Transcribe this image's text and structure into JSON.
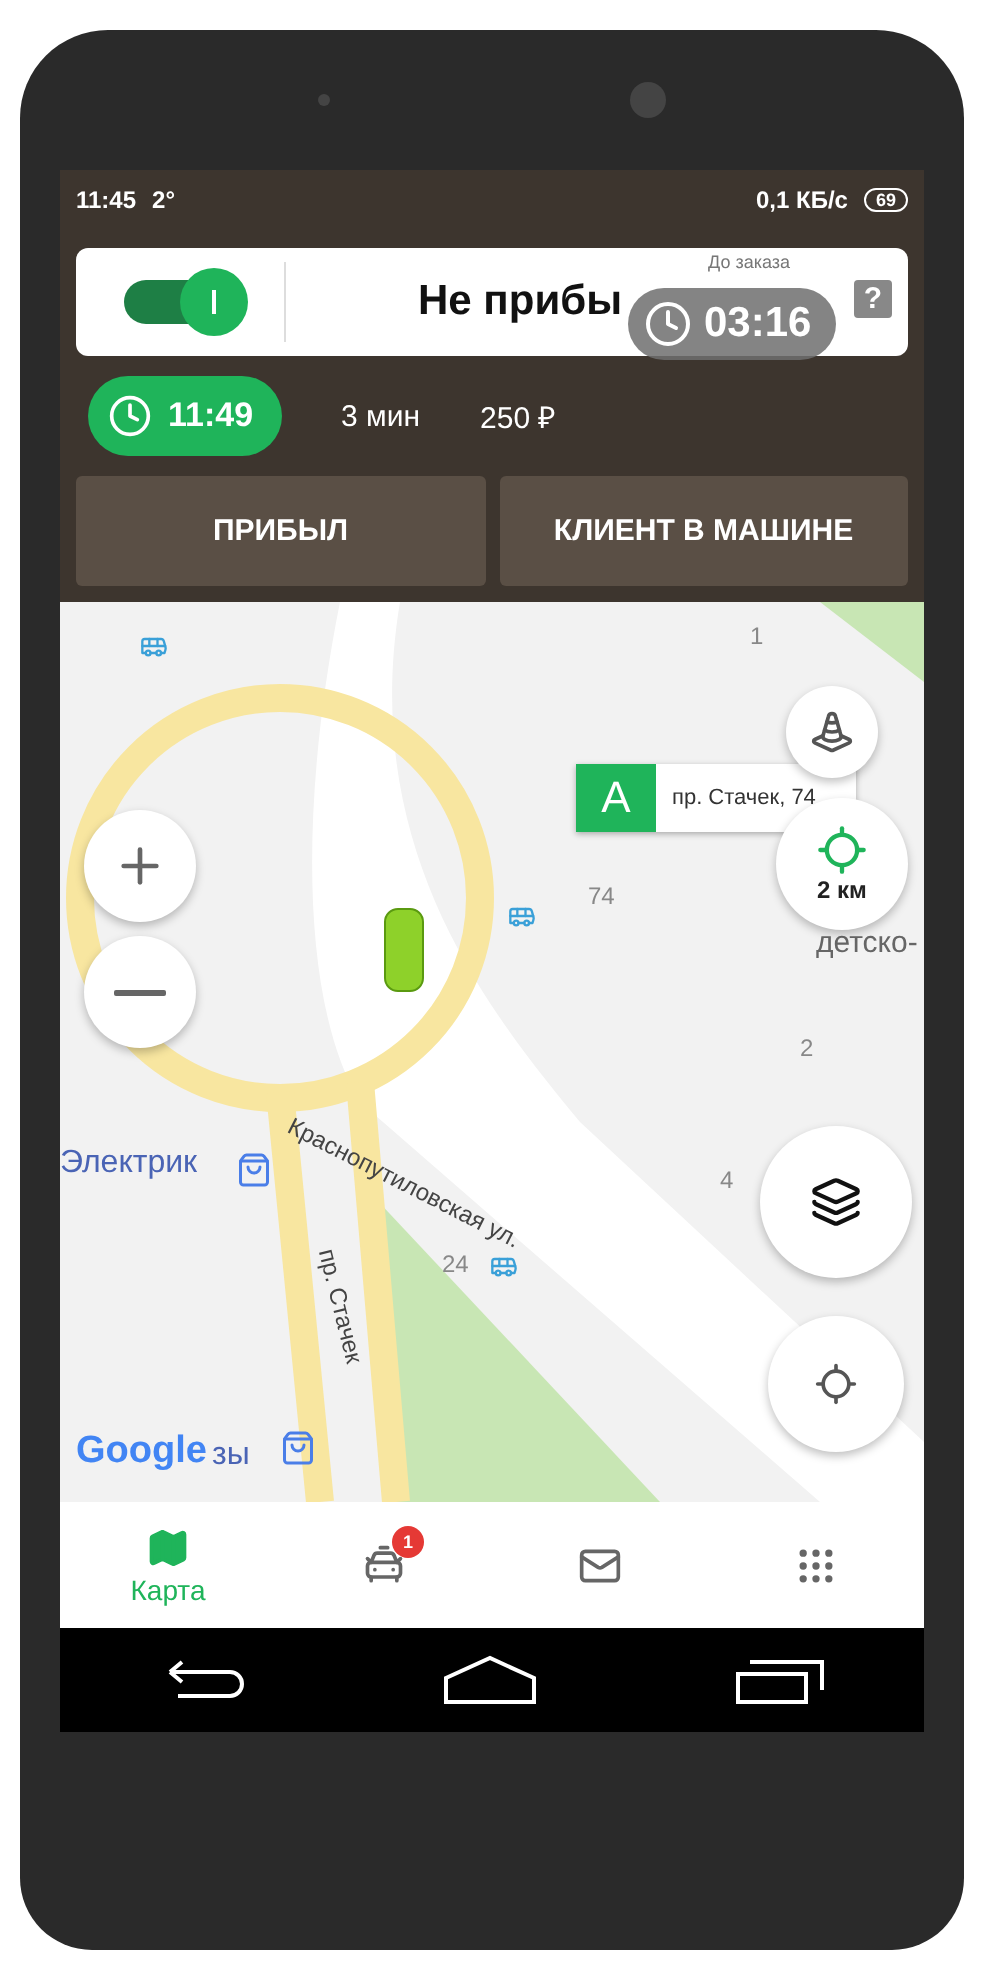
{
  "status_bar": {
    "time": "11:45",
    "temperature": "2°",
    "speed": "0,1 КБ/с",
    "battery": "69"
  },
  "header": {
    "online": true,
    "status": "Не прибы",
    "countdown_label": "До заказа",
    "countdown": "03:16",
    "help": "?"
  },
  "info": {
    "time": "11:49",
    "duration": "3 мин",
    "price": "250 ₽"
  },
  "actions": [
    {
      "label": "ПРИБЫЛ"
    },
    {
      "label": "КЛИЕНТ В МАШИНЕ"
    }
  ],
  "map": {
    "pickup": {
      "letter": "A",
      "address": "пр. Стачек, 74"
    },
    "radius": "2 км",
    "logo": "Google",
    "labels": [
      {
        "text": "Краснопутиловская ул.",
        "kind": "street"
      },
      {
        "text": "пр. Стачек",
        "kind": "street"
      },
      {
        "text": "Электрик",
        "kind": "place"
      },
      {
        "text": "зы",
        "kind": "place"
      },
      {
        "text": "детско-",
        "kind": "area"
      },
      {
        "text": "1",
        "kind": "house"
      },
      {
        "text": "74",
        "kind": "house"
      },
      {
        "text": "2",
        "kind": "house"
      },
      {
        "text": "4",
        "kind": "house"
      },
      {
        "text": "24",
        "kind": "house"
      }
    ]
  },
  "nav": [
    {
      "kind": "map",
      "label": "Карта",
      "selected": true
    },
    {
      "kind": "car",
      "badge": "1",
      "selected": false
    },
    {
      "kind": "mail",
      "selected": false
    },
    {
      "kind": "apps",
      "selected": false
    }
  ]
}
